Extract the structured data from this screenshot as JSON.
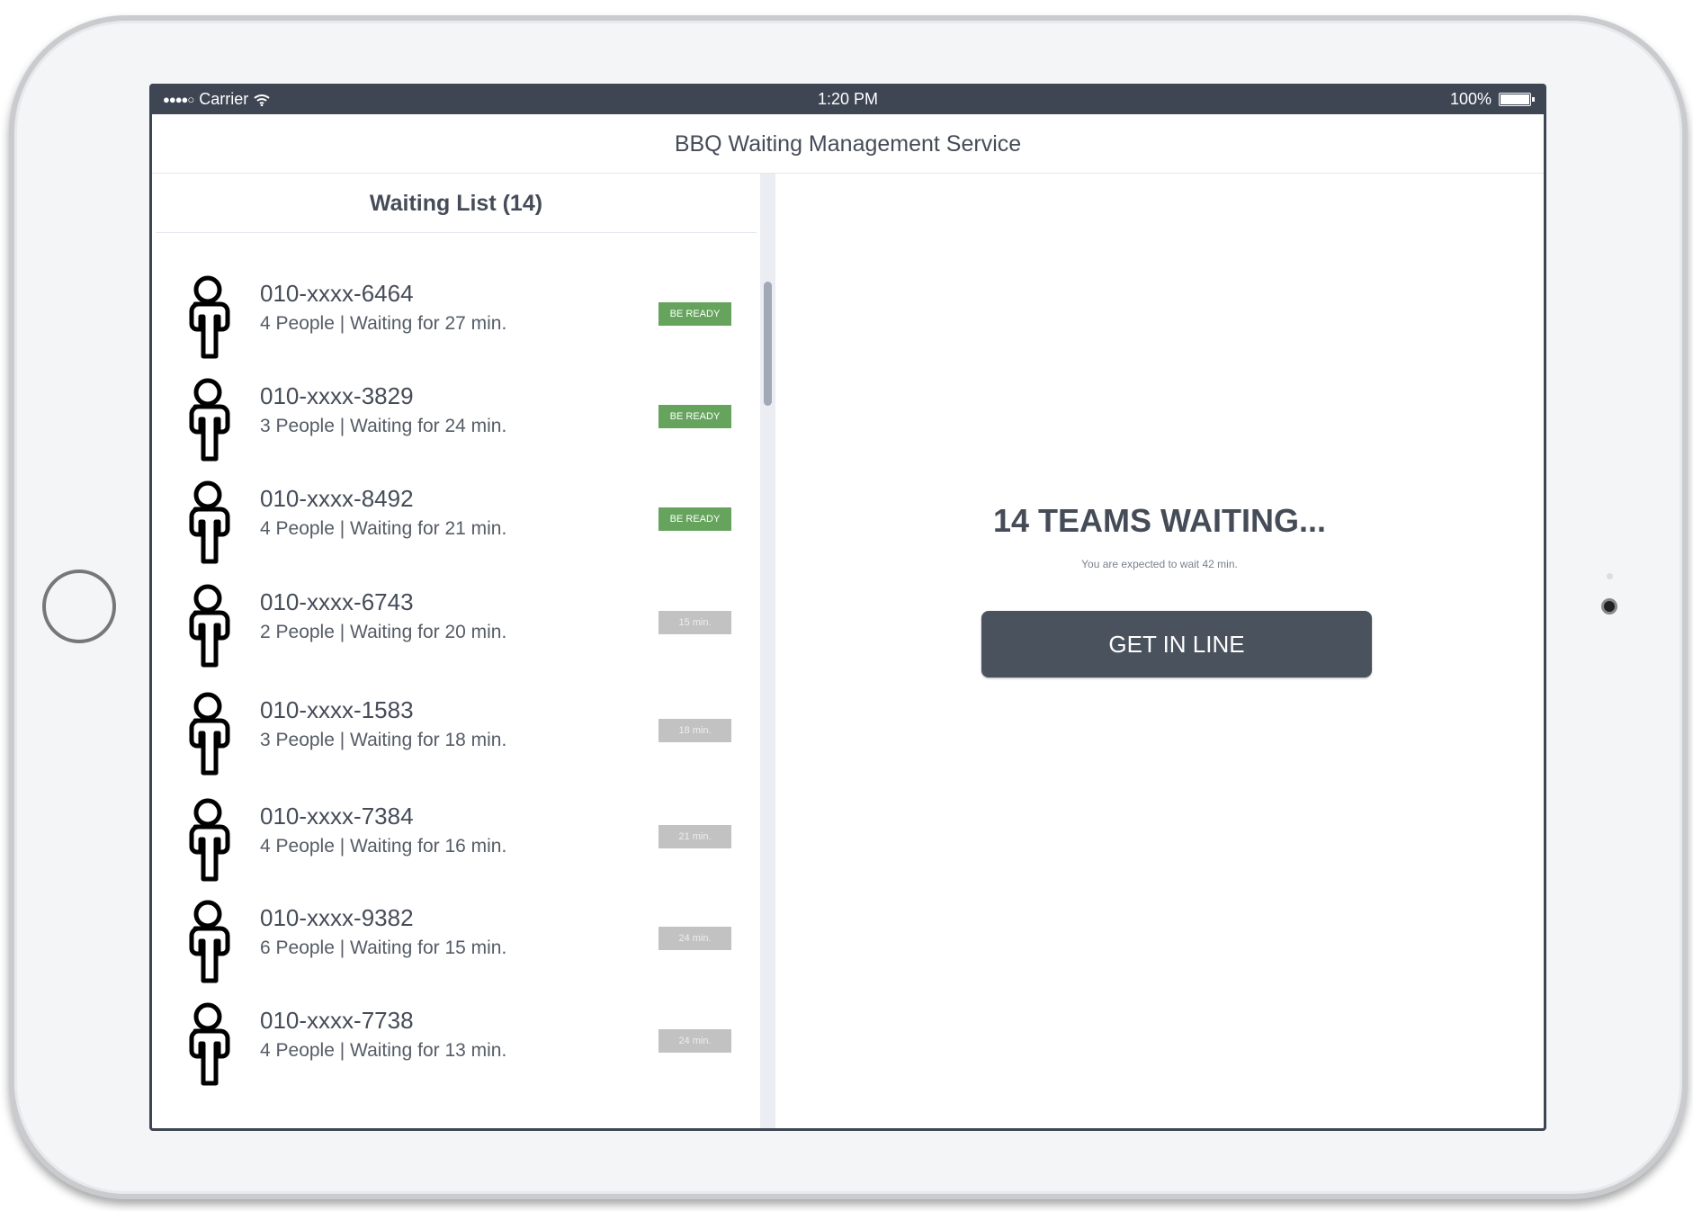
{
  "status_bar": {
    "carrier": "Carrier",
    "signal": "●●●●○",
    "time": "1:20 PM",
    "battery": "100%"
  },
  "header": {
    "title": "BBQ Waiting Management Service"
  },
  "waiting_list": {
    "title": "Waiting List (14)",
    "items": [
      {
        "phone": "010-xxxx-6464",
        "info": "4 People | Waiting for 27 min.",
        "badge": "BE READY",
        "status": "ready"
      },
      {
        "phone": "010-xxxx-3829",
        "info": "3 People | Waiting for 24 min.",
        "badge": "BE READY",
        "status": "ready"
      },
      {
        "phone": "010-xxxx-8492",
        "info": "4 People | Waiting for 21 min.",
        "badge": "BE READY",
        "status": "ready"
      },
      {
        "phone": "010-xxxx-6743",
        "info": "2 People | Waiting for 20 min.",
        "badge": "15 min.",
        "status": "waiting"
      },
      {
        "phone": "010-xxxx-1583",
        "info": "3 People | Waiting for 18 min.",
        "badge": "18 min.",
        "status": "waiting"
      },
      {
        "phone": "010-xxxx-7384",
        "info": "4 People | Waiting for 16 min.",
        "badge": "21 min.",
        "status": "waiting"
      },
      {
        "phone": "010-xxxx-9382",
        "info": "6 People | Waiting for 15 min.",
        "badge": "24 min.",
        "status": "waiting"
      },
      {
        "phone": "010-xxxx-7738",
        "info": "4 People | Waiting for 13 min.",
        "badge": "24 min.",
        "status": "waiting"
      }
    ]
  },
  "summary": {
    "teams": "14 TEAMS WAITING...",
    "expected": "You are expected to wait 42 min.",
    "button": "GET IN LINE"
  },
  "colors": {
    "ready": "#66a45e",
    "waiting": "#c2c2c2",
    "dark": "#3e4653"
  }
}
